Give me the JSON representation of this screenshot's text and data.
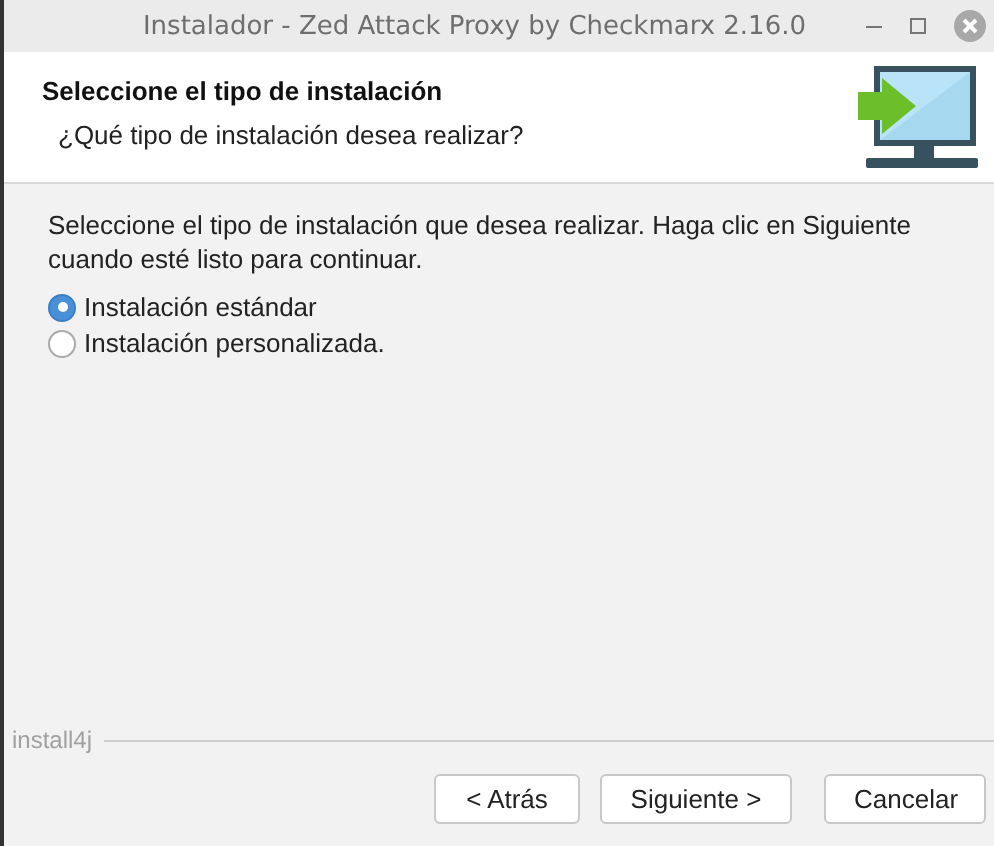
{
  "window": {
    "title": "Instalador - Zed Attack Proxy by Checkmarx 2.16.0"
  },
  "header": {
    "title": "Seleccione el tipo de instalación",
    "subtitle": "¿Qué tipo de instalación desea realizar?"
  },
  "instructions": "Seleccione el tipo de instalación que desea realizar. Haga clic en Siguiente cuando esté listo para continuar.",
  "options": [
    {
      "label": "Instalación estándar",
      "selected": true
    },
    {
      "label": "Instalación personalizada.",
      "selected": false
    }
  ],
  "footer": {
    "brand": "install4j"
  },
  "buttons": [
    {
      "label": "< Atrás"
    },
    {
      "label": "Siguiente >"
    },
    {
      "label": "Cancelar"
    }
  ]
}
